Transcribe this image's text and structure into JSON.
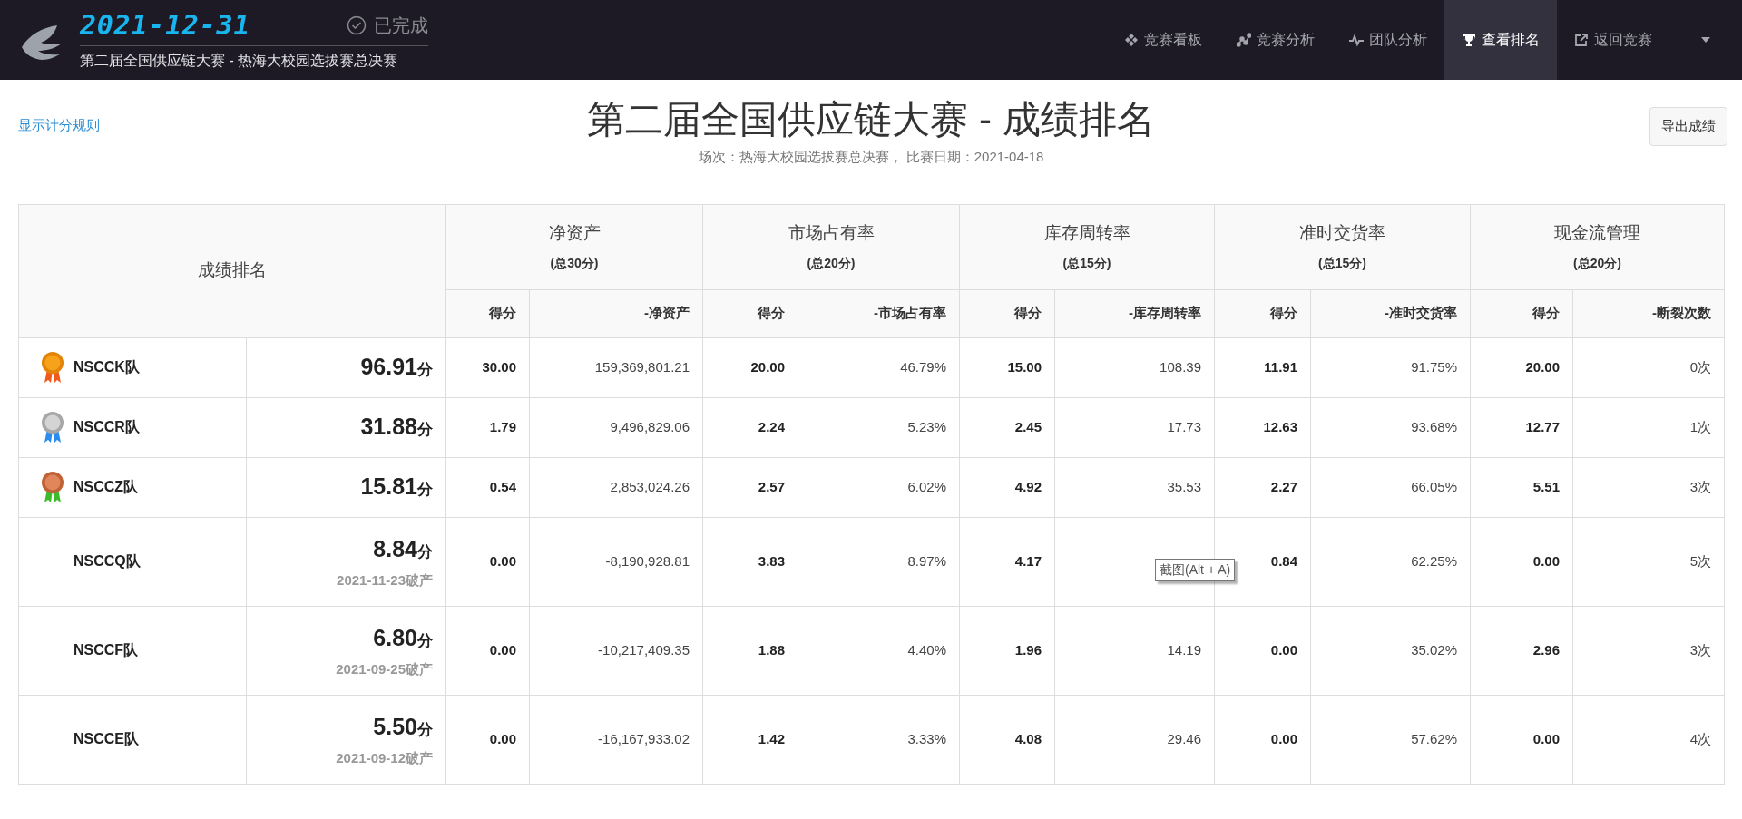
{
  "header": {
    "date": "2021-12-31",
    "status": "已完成",
    "subtitle": "第二届全国供应链大赛 - 热海大校园选拔赛总决赛"
  },
  "nav": [
    {
      "label": "竞赛看板",
      "kind": "board",
      "selected": false
    },
    {
      "label": "竞赛分析",
      "kind": "analysis",
      "selected": false
    },
    {
      "label": "团队分析",
      "kind": "team",
      "selected": false
    },
    {
      "label": "查看排名",
      "kind": "ranking",
      "selected": true
    },
    {
      "label": "返回竞赛",
      "kind": "back",
      "selected": false
    }
  ],
  "rules_link": "显示计分规则",
  "title": "第二届全国供应链大赛 - 成绩排名",
  "meta": "场次：热海大校园选拔赛总决赛， 比赛日期：2021-04-18",
  "export_button": "导出成绩",
  "table": {
    "rank_heading": "成绩排名",
    "groups": [
      {
        "name": "净资产",
        "total": "(总30分)",
        "sub": [
          "得分",
          "-净资产"
        ]
      },
      {
        "name": "市场占有率",
        "total": "(总20分)",
        "sub": [
          "得分",
          "-市场占有率"
        ]
      },
      {
        "name": "库存周转率",
        "total": "(总15分)",
        "sub": [
          "得分",
          "-库存周转率"
        ]
      },
      {
        "name": "准时交货率",
        "total": "(总15分)",
        "sub": [
          "得分",
          "-准时交货率"
        ]
      },
      {
        "name": "现金流管理",
        "total": "(总20分)",
        "sub": [
          "得分",
          "-断裂次数"
        ]
      }
    ],
    "rows": [
      {
        "kind": "gold",
        "team": "NSCCK队",
        "score": "96.91",
        "unit": "分",
        "cells": [
          "30.00",
          "159,369,801.21",
          "20.00",
          "46.79%",
          "15.00",
          "108.39",
          "11.91",
          "91.75%",
          "20.00",
          "0次"
        ]
      },
      {
        "kind": "silver",
        "team": "NSCCR队",
        "score": "31.88",
        "unit": "分",
        "cells": [
          "1.79",
          "9,496,829.06",
          "2.24",
          "5.23%",
          "2.45",
          "17.73",
          "12.63",
          "93.68%",
          "12.77",
          "1次"
        ]
      },
      {
        "kind": "bronze",
        "team": "NSCCZ队",
        "score": "15.81",
        "unit": "分",
        "cells": [
          "0.54",
          "2,853,024.26",
          "2.57",
          "6.02%",
          "4.92",
          "35.53",
          "2.27",
          "66.05%",
          "5.51",
          "3次"
        ]
      },
      {
        "kind": "plain",
        "team": "NSCCQ队",
        "score": "8.84",
        "unit": "分",
        "bankrupt": "2021-11-23破产",
        "cells": [
          "0.00",
          "-8,190,928.81",
          "3.83",
          "8.97%",
          "4.17",
          null,
          "0.84",
          "62.25%",
          "0.00",
          "5次"
        ],
        "tooltip": "截图(Alt + A)"
      },
      {
        "kind": "plain",
        "team": "NSCCF队",
        "score": "6.80",
        "unit": "分",
        "bankrupt": "2021-09-25破产",
        "cells": [
          "0.00",
          "-10,217,409.35",
          "1.88",
          "4.40%",
          "1.96",
          "14.19",
          "0.00",
          "35.02%",
          "2.96",
          "3次"
        ]
      },
      {
        "kind": "plain",
        "team": "NSCCE队",
        "score": "5.50",
        "unit": "分",
        "bankrupt": "2021-09-12破产",
        "cells": [
          "0.00",
          "-16,167,933.02",
          "1.42",
          "3.33%",
          "4.08",
          "29.46",
          "0.00",
          "57.62%",
          "0.00",
          "4次"
        ]
      }
    ]
  }
}
